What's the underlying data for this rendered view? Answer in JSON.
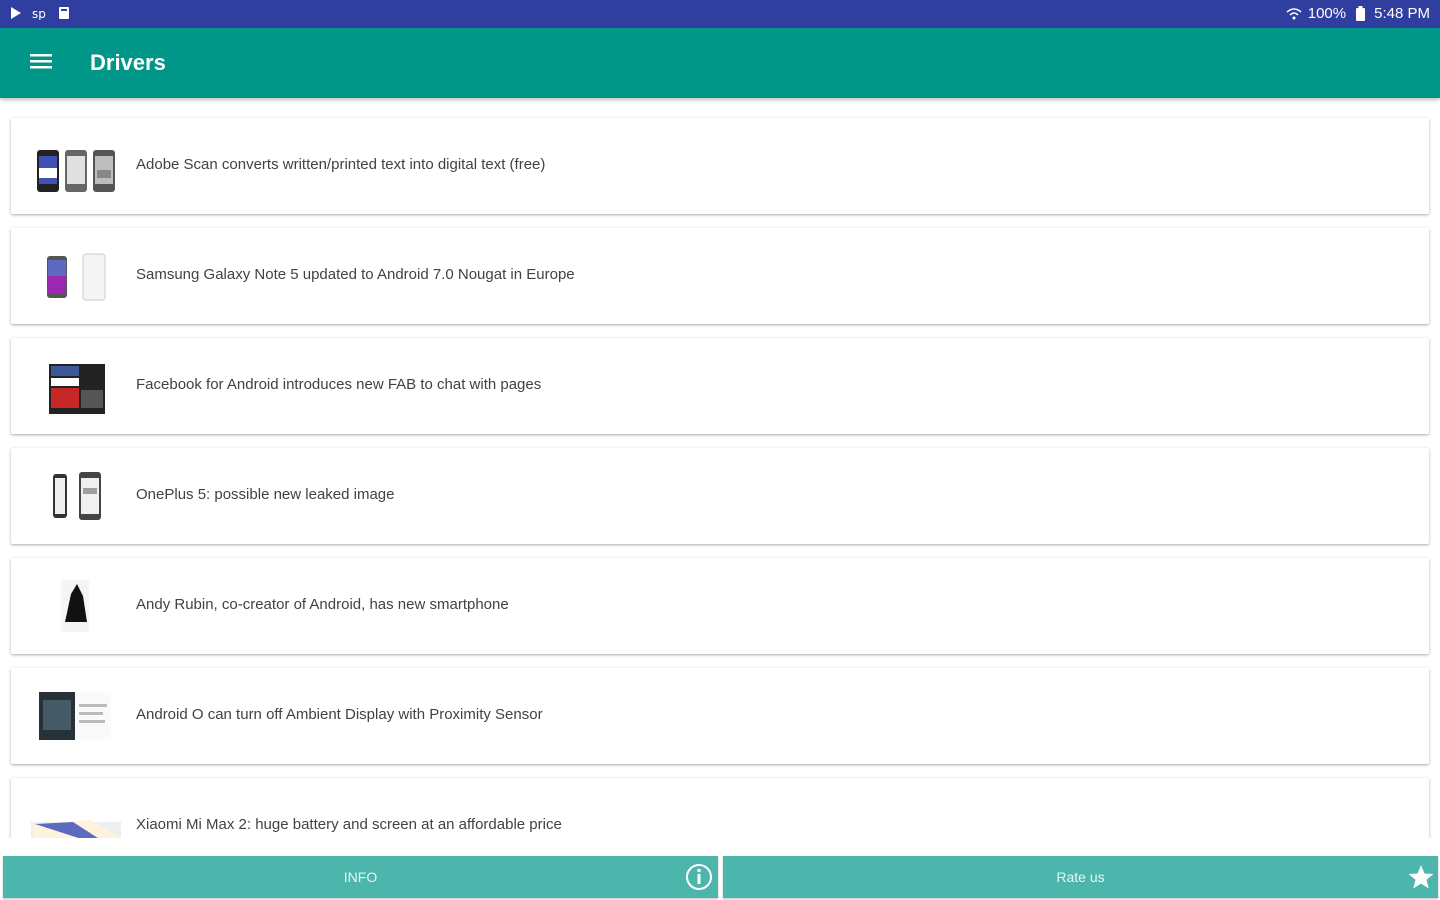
{
  "status_bar": {
    "left_icons": [
      "play-store-icon",
      "sync-icon",
      "download-icon"
    ],
    "wifi": "wifi-icon",
    "battery_percent": "100%",
    "battery_icon": "battery-icon",
    "time": "5:48 PM"
  },
  "app_bar": {
    "menu_icon": "hamburger-menu-icon",
    "title": "Drivers"
  },
  "articles": [
    {
      "title": "Adobe Scan converts written/printed text into digital text (free)",
      "thumb": "three-phones-thumbnail"
    },
    {
      "title": "Samsung Galaxy Note 5 updated to Android 7.0 Nougat in Europe",
      "thumb": "galaxy-note-thumbnail"
    },
    {
      "title": "Facebook for Android introduces new FAB to chat with pages",
      "thumb": "facebook-screens-thumbnail"
    },
    {
      "title": "OnePlus 5: possible new leaked image",
      "thumb": "oneplus-phones-thumbnail"
    },
    {
      "title": "Andy Rubin, co-creator of Android, has new smartphone",
      "thumb": "black-phone-thumbnail"
    },
    {
      "title": "Android O can turn off Ambient Display with Proximity Sensor",
      "thumb": "tablet-screen-thumbnail"
    },
    {
      "title": "Xiaomi Mi Max 2: huge battery and screen at an affordable price",
      "thumb": "xiaomi-phone-thumbnail"
    }
  ],
  "bottom_bar": {
    "info_label": "INFO",
    "info_icon": "info-icon",
    "rate_label": "Rate us",
    "rate_icon": "star-icon"
  },
  "colors": {
    "status_bar": "#303f9f",
    "app_bar": "#009688",
    "bottom_button": "#4db6ac"
  }
}
